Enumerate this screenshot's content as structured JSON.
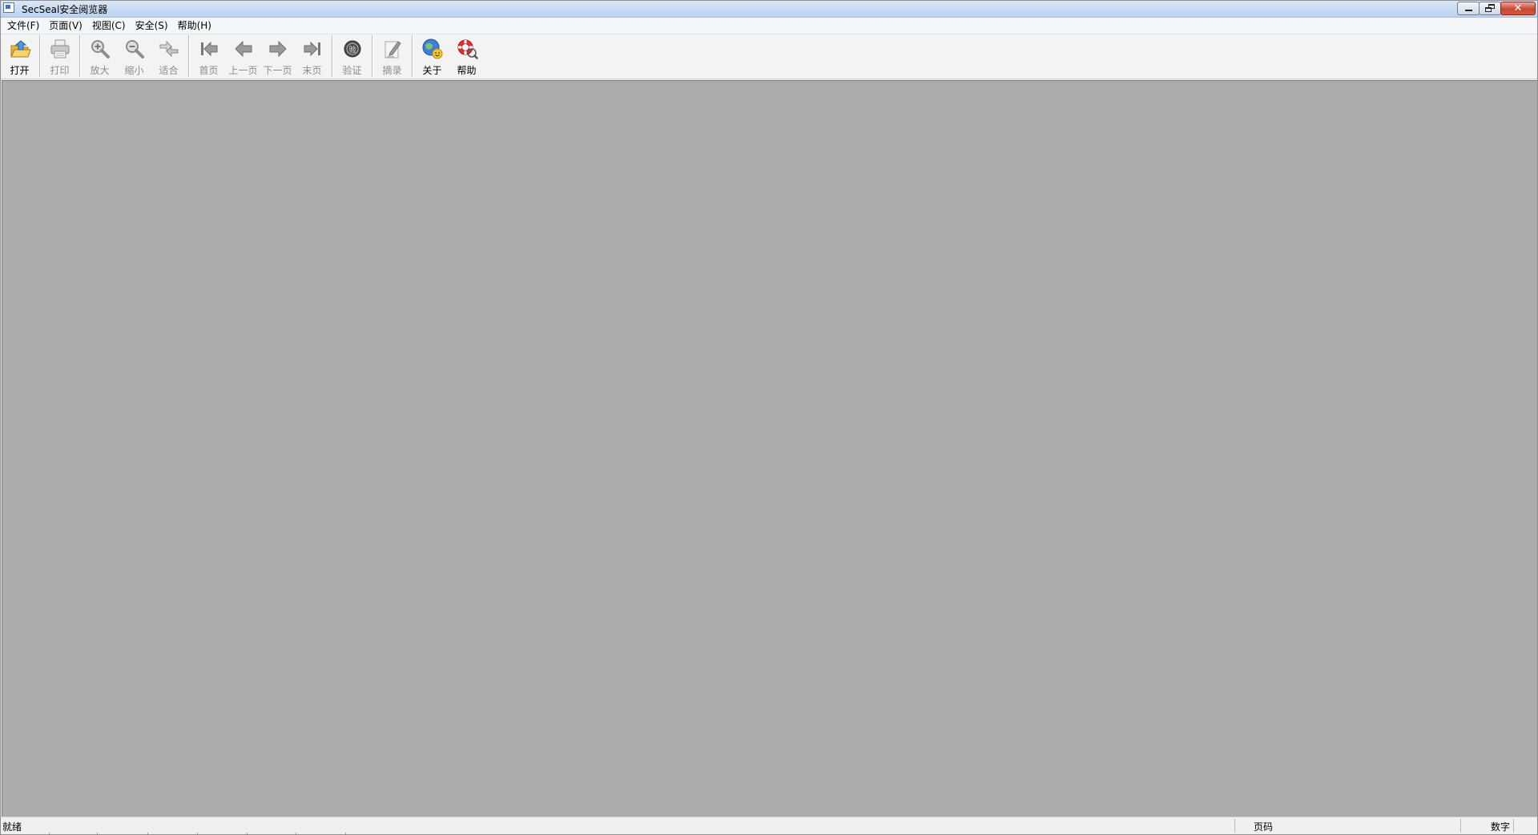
{
  "window": {
    "title": "SecSeal安全阅览器"
  },
  "menu": {
    "items": [
      {
        "label": "文件(F)"
      },
      {
        "label": "页面(V)"
      },
      {
        "label": "视图(C)"
      },
      {
        "label": "安全(S)"
      },
      {
        "label": "帮助(H)"
      }
    ]
  },
  "toolbar": {
    "open": {
      "label": "打开",
      "icon": "open-folder-icon",
      "enabled": true
    },
    "print": {
      "label": "打印",
      "icon": "printer-icon",
      "enabled": false
    },
    "zoom_in": {
      "label": "放大",
      "icon": "zoom-in-icon",
      "enabled": false
    },
    "zoom_out": {
      "label": "缩小",
      "icon": "zoom-out-icon",
      "enabled": false
    },
    "fit": {
      "label": "适合",
      "icon": "fit-icon",
      "enabled": false
    },
    "first_page": {
      "label": "首页",
      "icon": "first-page-icon",
      "enabled": false
    },
    "prev_page": {
      "label": "上一页",
      "icon": "prev-page-icon",
      "enabled": false
    },
    "next_page": {
      "label": "下一页",
      "icon": "next-page-icon",
      "enabled": false
    },
    "last_page": {
      "label": "末页",
      "icon": "last-page-icon",
      "enabled": false
    },
    "verify": {
      "label": "验证",
      "icon": "verify-seal-icon",
      "enabled": false
    },
    "excerpt": {
      "label": "摘录",
      "icon": "excerpt-pen-icon",
      "enabled": false
    },
    "about": {
      "label": "关于",
      "icon": "about-globe-icon",
      "enabled": true
    },
    "help": {
      "label": "帮助",
      "icon": "help-lifebuoy-icon",
      "enabled": true
    }
  },
  "statusbar": {
    "status": "就绪",
    "page_label": "页码",
    "num_label": "数字"
  },
  "colors": {
    "doc_background": "#ababab",
    "toolbar_background": "#f3f3f3",
    "close_button": "#c84a30"
  }
}
